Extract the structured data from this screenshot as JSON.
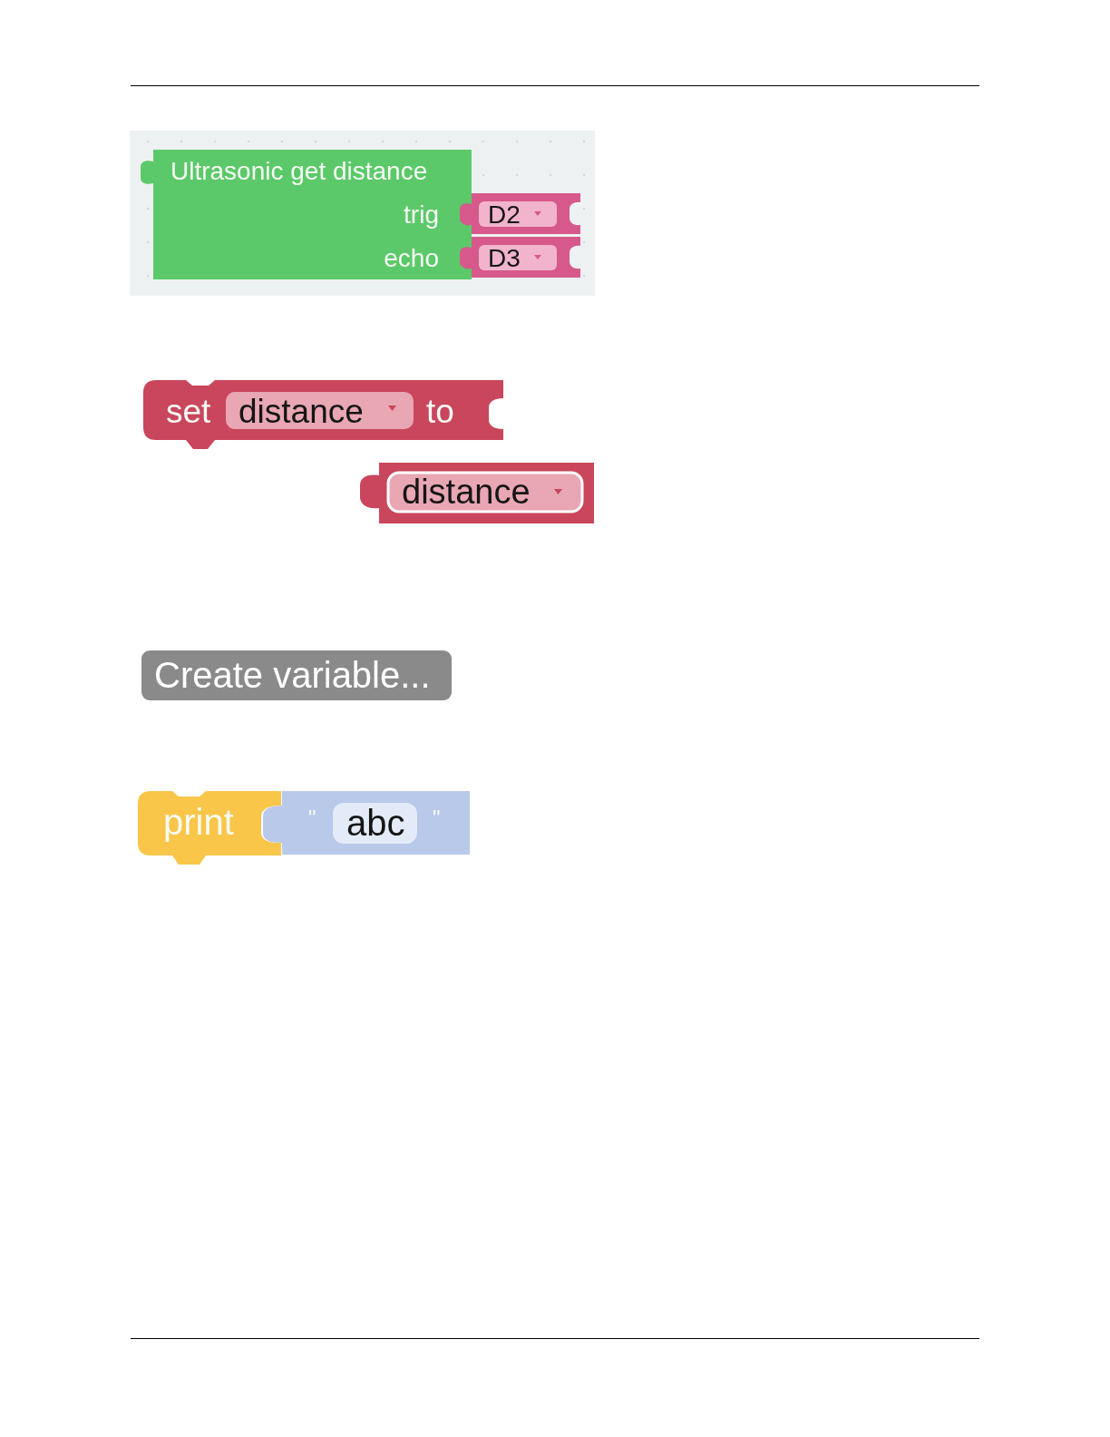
{
  "figures": [
    {
      "kind": "sensor_block",
      "title": "Ultrasonic get distance",
      "inputs": [
        {
          "label": "trig",
          "value": "D2"
        },
        {
          "label": "echo",
          "value": "D3"
        }
      ]
    },
    {
      "kind": "variable_blocks",
      "setter": {
        "keyword": "set",
        "variable": "distance",
        "connector": "to"
      },
      "getter": {
        "variable": "distance"
      }
    },
    {
      "kind": "button",
      "label": "Create variable..."
    },
    {
      "kind": "print_block",
      "keyword": "print",
      "open_quote": "\"",
      "text": "abc",
      "close_quote": "\""
    }
  ]
}
